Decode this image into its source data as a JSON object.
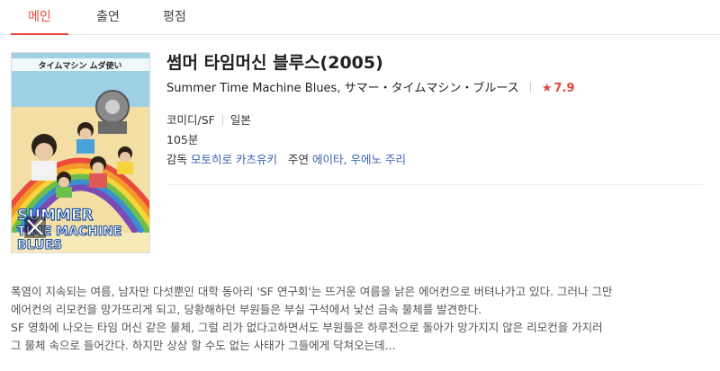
{
  "tabs": [
    {
      "label": "메인",
      "active": true
    },
    {
      "label": "출연",
      "active": false
    },
    {
      "label": "평점",
      "active": false
    }
  ],
  "poster": {
    "top_text": "タイムマシン ムダ使い",
    "big_text_1": "SUMMER",
    "big_text_2": "TIME MACHINE",
    "big_text_3": "BLUES"
  },
  "movie": {
    "title": "썸머 타임머신 블루스(2005)",
    "english_title": "Summer Time Machine Blues,",
    "japanese_title": "サマー・タイムマシン・ブルース",
    "rating": "7.9",
    "genre": "코미디/SF",
    "country": "일본",
    "runtime": "105분",
    "director_label": "감독",
    "director": "모토히로 카츠유키",
    "cast_label": "주연",
    "cast_1": "에이타",
    "cast_separator": ", ",
    "cast_2": "우에노 주리"
  },
  "synopsis": {
    "line_1": "폭염이 지속되는 여름, 남자만 다섯뿐인 대학 동아리 'SF 연구회'는 뜨거운 여름을 낡은 에어컨으로 버텨나가고 있다. 그러나 그만",
    "line_2": "에어컨의 리모컨을 망가뜨리게 되고, 당황해하던 부원들은 부실 구석에서 낯선 금속 물체를 발견한다.",
    "line_3": "SF 영화에 나오는 타임 머신 같은 물체, 그럴 리가 없다고하면서도 부원들은 하루전으로 돌아가 망가지지 않은 리모컨을 가지러",
    "line_4": "그 물체 속으로 들어간다. 하지만 상상 할 수도 없는 사태가 그들에게 닥쳐오는데..."
  },
  "colors": {
    "accent": "#e8443a",
    "link": "#3a62b3"
  }
}
